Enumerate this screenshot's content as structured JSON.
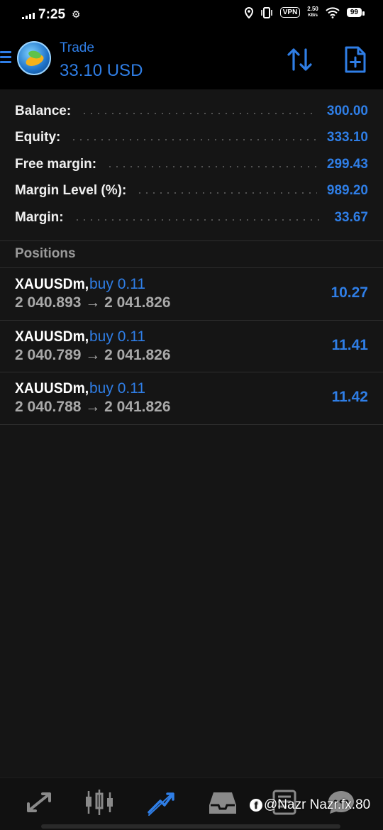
{
  "status_bar": {
    "time": "7:25",
    "vpn": "VPN",
    "speed_value": "2.50",
    "speed_unit": "KB/s",
    "battery": "99"
  },
  "header": {
    "title": "Trade",
    "subtitle": "33.10 USD",
    "accent": "#2f7ee6"
  },
  "summary": [
    {
      "label": "Balance:",
      "value": "300.00"
    },
    {
      "label": "Equity:",
      "value": "333.10"
    },
    {
      "label": "Free margin:",
      "value": "299.43"
    },
    {
      "label": "Margin Level (%):",
      "value": "989.20"
    },
    {
      "label": "Margin:",
      "value": "33.67"
    }
  ],
  "positions_title": "Positions",
  "positions": [
    {
      "symbol": "XAUUSDm,",
      "side": "buy 0.11",
      "prices": "2 040.893 → 2 041.826",
      "profit": "10.27"
    },
    {
      "symbol": "XAUUSDm,",
      "side": "buy 0.11",
      "prices": "2 040.789 → 2 041.826",
      "profit": "11.41"
    },
    {
      "symbol": "XAUUSDm,",
      "side": "buy 0.11",
      "prices": "2 040.788 → 2 041.826",
      "profit": "11.42"
    }
  ],
  "bottom_nav": [
    {
      "icon": "quotes-icon",
      "active": false
    },
    {
      "icon": "chart-icon",
      "active": false
    },
    {
      "icon": "trade-icon",
      "active": true
    },
    {
      "icon": "history-icon",
      "active": false
    },
    {
      "icon": "news-icon",
      "active": false
    },
    {
      "icon": "messages-icon",
      "active": false
    }
  ],
  "watermark": "@Nazr Nazr.fx.80"
}
